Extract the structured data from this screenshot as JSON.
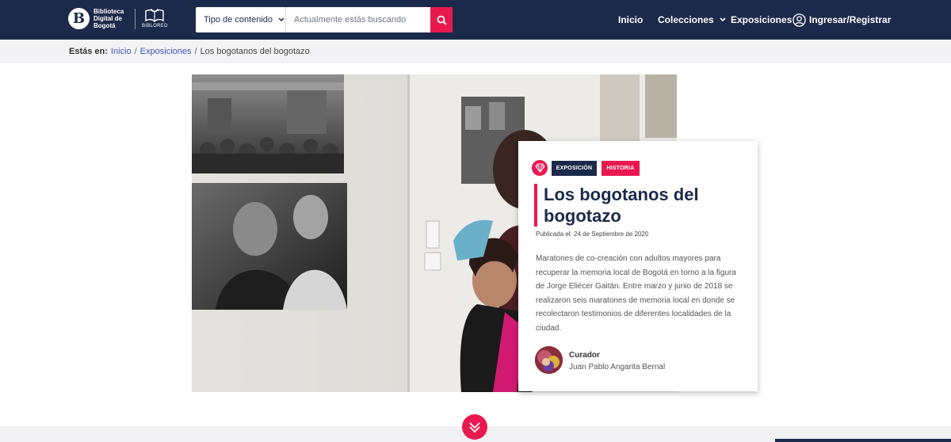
{
  "header": {
    "logo_text": [
      "Biblioteca",
      "Digital de",
      "Bogotá"
    ],
    "logo_letter": "B",
    "biblored_text": "BIBLORED",
    "search": {
      "type_label": "Tipo de contenido",
      "placeholder": "Actualmente estás buscando"
    },
    "nav": {
      "inicio": "Inicio",
      "colecciones": "Colecciones",
      "exposiciones": "Exposiciones",
      "login": "Ingresar/Registrar"
    }
  },
  "breadcrumb": {
    "label": "Estás en:",
    "items": [
      "Inicio",
      "Exposiciones",
      "Los bogotanos del bogotazo"
    ],
    "separator": "/"
  },
  "card": {
    "tags": [
      "EXPOSICIÓN",
      "HISTORIA"
    ],
    "title": "Los bogotanos del bogotazo",
    "date": "Publicada el: 24 de Septiembre de 2020",
    "description": "Maratones de co-creación con adultos mayores para recuperar la memoria local de Bogotá en torno a la figura de Jorge Eliécer Gaitán. Entre marzo y junio de 2018 se realizaron seis maratones de memoria local en donde se recolectaron testimonios de diferentes localidades de la ciudad.",
    "curator_label": "Curador",
    "curator_name": "Juan Pablo Angarita Bernal"
  },
  "colors": {
    "navy": "#1b2a4a",
    "accent": "#e8194f",
    "link": "#3a56b6"
  },
  "icons": {
    "search": "search-icon",
    "chevron": "chevron-down-icon",
    "user": "user-icon",
    "badge": "gem-icon",
    "scroll": "double-chevron-down-icon"
  }
}
